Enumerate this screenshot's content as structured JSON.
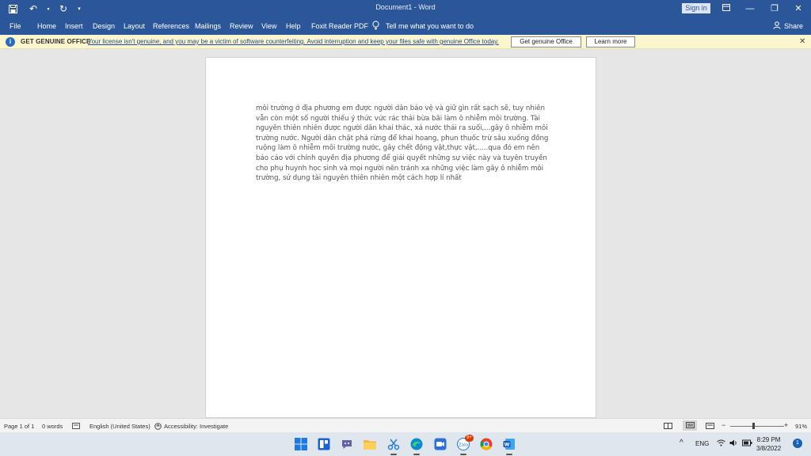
{
  "window": {
    "title": "Document1 - Word",
    "sign_in": "Sign in"
  },
  "ribbon": {
    "tabs": [
      "File",
      "Home",
      "Insert",
      "Design",
      "Layout",
      "References",
      "Mailings",
      "Review",
      "View",
      "Help",
      "Foxit Reader PDF"
    ],
    "tell_me": "Tell me what you want to do",
    "share": "Share"
  },
  "message_bar": {
    "title": "GET GENUINE OFFICE",
    "text": "Your license isn't genuine, and you may be a victim of software counterfeiting. Avoid interruption and keep your files safe with genuine Office today.",
    "primary_button": "Get genuine Office",
    "secondary_button": "Learn more"
  },
  "document": {
    "paragraph": "môi trường ở địa phương em được người dân bảo vệ và giữ gìn rất sạch sẽ, tuy nhiên vẫn còn một số người thiếu ý thức vức rác thải bừa bãi làm ô nhiễm môi trường. Tài nguyên thiên nhiên được người dân khai thác, xả nước thải ra suối,...gây ô nhiễm môi trường nước. Người dân chặt phá rừng để khai hoang, phun thuốc trừ sâu xuống đồng ruộng làm ô nhiễm môi trường nước, gây chết động vật,thực vật,.....qua đó em nên báo cáo với chính quyền địa phương để giải quyết những sự việc này và tuyên truyền cho phụ huynh học sinh và mọi người nên tránh xa những việc làm gây ô nhiễm môi trường, sử dụng tài nguyên thiên nhiên một cách hợp lí nhất"
  },
  "status": {
    "page": "Page 1 of 1",
    "words": "0 words",
    "language": "English (United States)",
    "accessibility": "Accessibility: Investigate",
    "zoom": "91%",
    "zoom_level_percent": 91
  },
  "taskbar": {
    "badge": "9+",
    "language": "ENG",
    "time": "8:29 PM",
    "date": "3/8/2022",
    "notification_count": "1"
  },
  "colors": {
    "word_blue": "#2b579a",
    "message_bar": "#fcf6cf"
  }
}
